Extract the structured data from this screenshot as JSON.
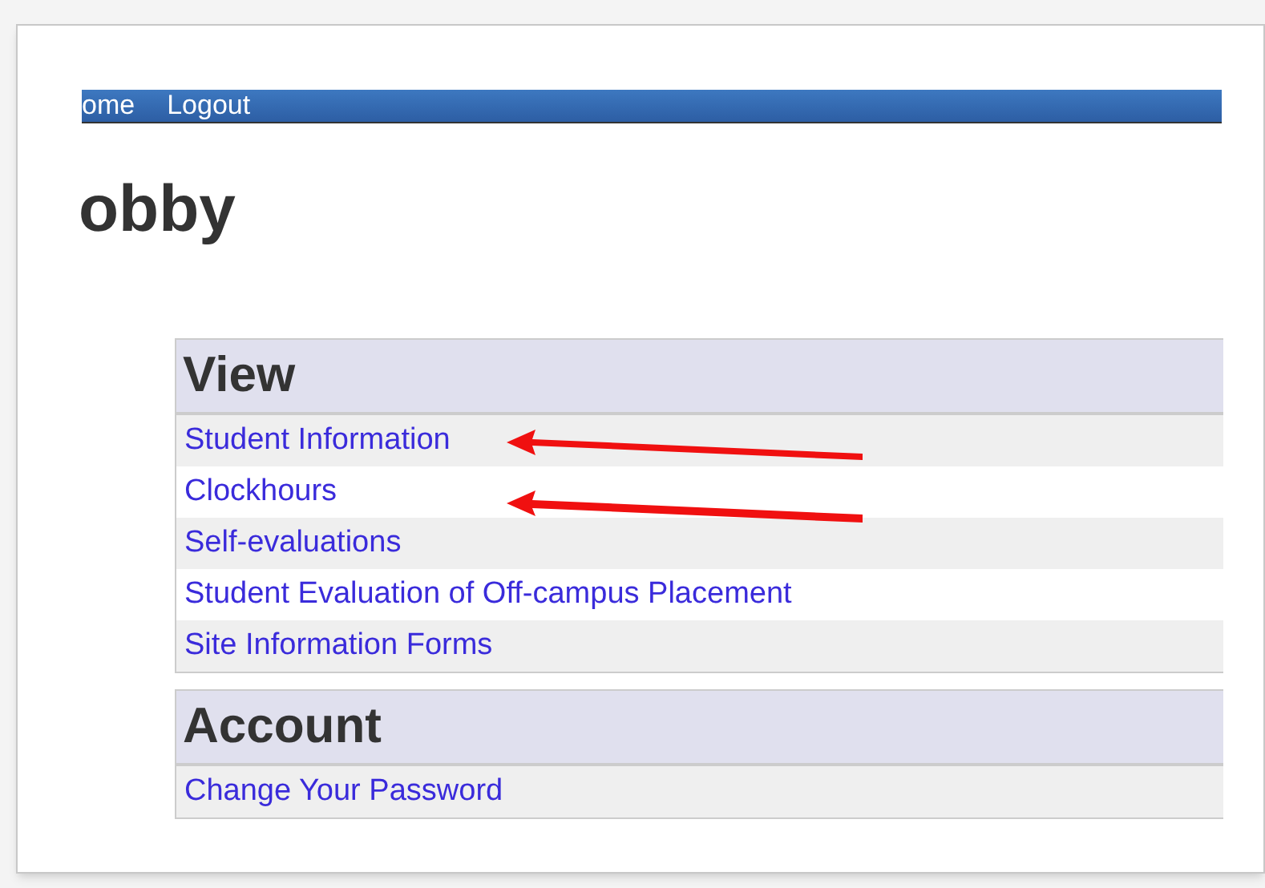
{
  "nav": {
    "items": [
      "ome",
      "Logout"
    ]
  },
  "page_title": "obby",
  "sections": [
    {
      "title": "View",
      "links": [
        "Student Information",
        "Clockhours",
        "Self-evaluations",
        "Student Evaluation of Off-campus Placement",
        "Site Information Forms"
      ]
    },
    {
      "title": "Account",
      "links": [
        "Change Your Password"
      ]
    }
  ]
}
